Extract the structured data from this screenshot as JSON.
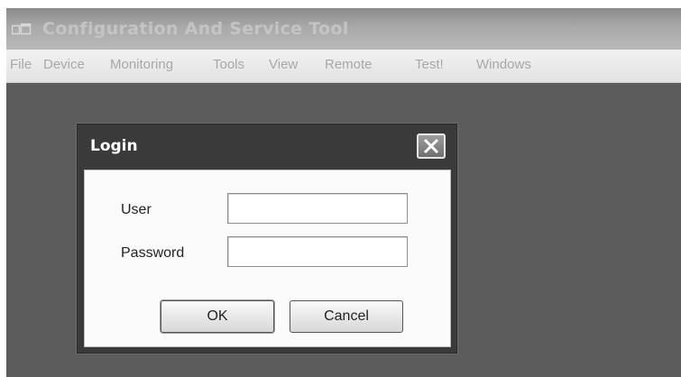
{
  "window": {
    "title": "Configuration And Service Tool",
    "icon": "app-window-icon"
  },
  "menu": {
    "items": [
      "File",
      "Device",
      "Monitoring",
      "Tools",
      "View",
      "Remote",
      "Test!",
      "Windows"
    ]
  },
  "dialog": {
    "title": "Login",
    "close_icon": "close-icon",
    "fields": {
      "user_label": "User",
      "user_value": "",
      "password_label": "Password",
      "password_value": ""
    },
    "buttons": {
      "ok": "OK",
      "cancel": "Cancel"
    }
  }
}
